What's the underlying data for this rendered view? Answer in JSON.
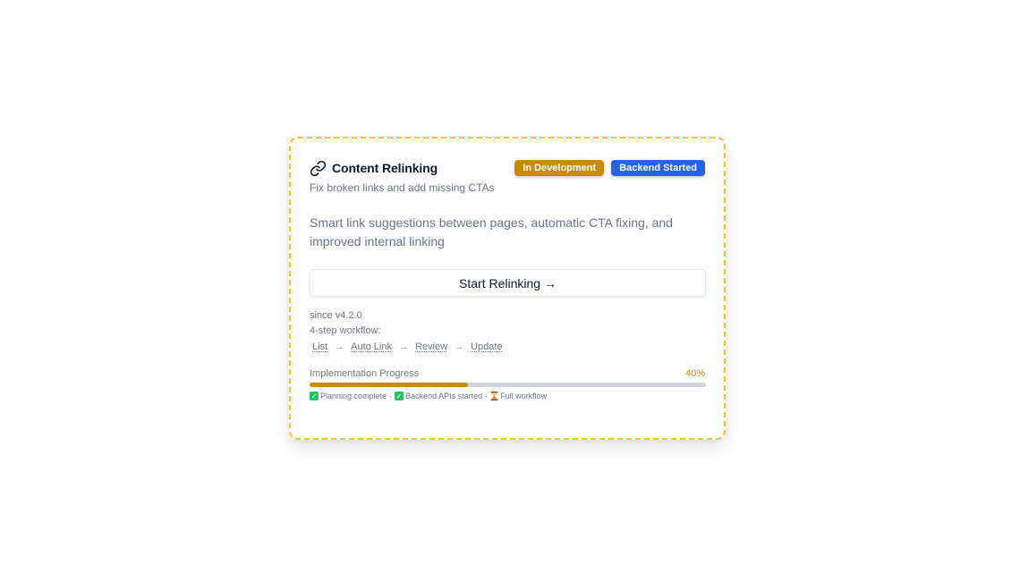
{
  "card": {
    "title": "Content Relinking",
    "icon": "link-icon",
    "badges": [
      {
        "label": "In Development",
        "color": "#ca8a04"
      },
      {
        "label": "Backend Started",
        "color": "#2563eb"
      }
    ],
    "subtitle": "Fix broken links and add missing CTAs",
    "description": "Smart link suggestions between pages, automatic CTA fixing, and improved internal linking",
    "button_label": "Start Relinking →",
    "since": "since v4.2.0",
    "workflow_label": "4-step workflow:",
    "steps": [
      "List",
      "Auto Link",
      "Review",
      "Update"
    ],
    "step_separator": "→",
    "progress": {
      "label": "Implementation Progress",
      "percent_label": "40%",
      "value": 0.4,
      "color": "#ca8a04"
    },
    "milestones": [
      {
        "icon": "check-icon",
        "label": "Planning complete"
      },
      {
        "icon": "check-icon",
        "label": "Backend APIs started"
      },
      {
        "icon": "hourglass-icon",
        "label": "Full workflow"
      }
    ],
    "milestone_separator": "·",
    "border_color": "#f5c518"
  }
}
